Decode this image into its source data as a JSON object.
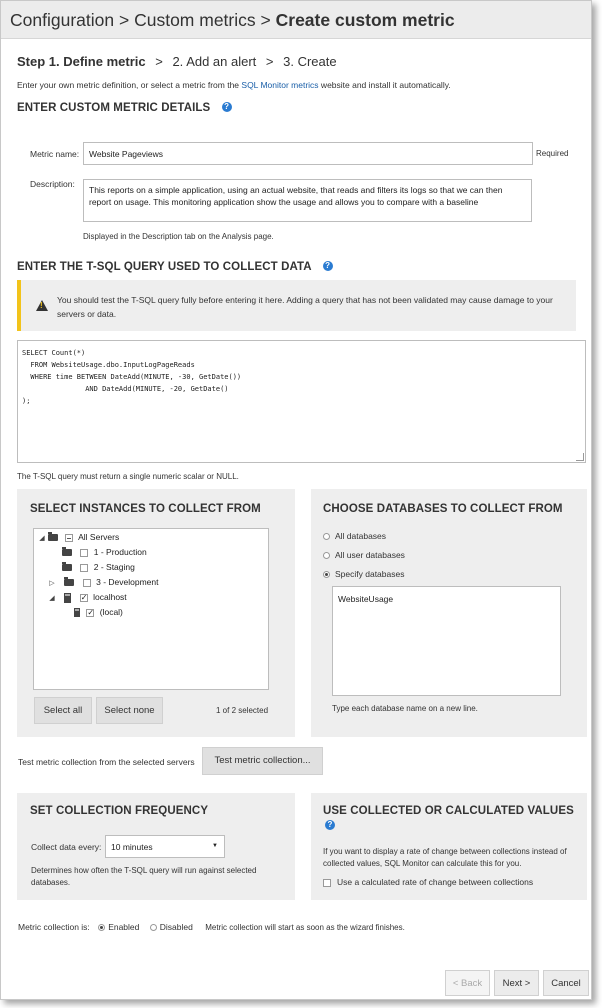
{
  "header": {
    "crumb1": "Configuration",
    "crumb2": "Custom metrics",
    "current": "Create custom metric",
    "sep": ">"
  },
  "steps": {
    "step1": "Step 1. Define metric",
    "step2": "2. Add an alert",
    "step3": "3. Create",
    "sep": ">"
  },
  "intro": {
    "before": "Enter your own metric definition, or select a metric from the ",
    "link": "SQL Monitor metrics",
    "after": " website and install it automatically."
  },
  "details": {
    "heading": "ENTER CUSTOM METRIC DETAILS",
    "name_label": "Metric name:",
    "name_value": "Website Pageviews",
    "required": "Required",
    "desc_label": "Description:",
    "desc_value": "This reports on  a simple application, using an actual website, that reads and filters its logs so that we can then report on usage.  This monitoring application  show the usage and allows you to compare with a baseline",
    "desc_hint": "Displayed in the Description tab on the Analysis page."
  },
  "query": {
    "heading": "ENTER THE T-SQL QUERY USED TO COLLECT DATA",
    "warning": "You should test the T-SQL query fully before entering it here. Adding a query that has not been validated may cause damage to your servers or data.",
    "sql": "SELECT Count(*)\n  FROM WebsiteUsage.dbo.InputLogPageReads\n  WHERE time BETWEEN DateAdd(MINUTE, -30, GetDate())\n               AND DateAdd(MINUTE, -20, GetDate()\n);",
    "hint": "The T-SQL query must return a single numeric scalar or NULL."
  },
  "instances": {
    "heading": "SELECT INSTANCES TO COLLECT FROM",
    "tree": [
      "All Servers",
      "1 - Production",
      "2 - Staging",
      "3 - Development",
      "localhost",
      "(local)"
    ],
    "select_all": "Select all",
    "select_none": "Select none",
    "count": "1 of 2 selected"
  },
  "databases": {
    "heading": "CHOOSE DATABASES TO COLLECT FROM",
    "options": [
      "All databases",
      "All user databases",
      "Specify databases"
    ],
    "selected": "Specify databases",
    "value": "WebsiteUsage",
    "hint": "Type each database name on a new line."
  },
  "test": {
    "label": "Test metric collection from the selected servers",
    "button": "Test metric collection..."
  },
  "frequency": {
    "heading": "SET COLLECTION FREQUENCY",
    "label": "Collect data every:",
    "value": "10 minutes",
    "hint": "Determines how often the T-SQL query will run against selected databases."
  },
  "values": {
    "heading": "USE COLLECTED OR CALCULATED VALUES",
    "text": "If you want to display a rate of change between collections instead of collected values, SQL Monitor can calculate this for you.",
    "checkbox": "Use a calculated rate of change between collections"
  },
  "collection": {
    "label": "Metric collection is:",
    "enabled": "Enabled",
    "disabled": "Disabled",
    "note": "Metric collection will start as soon as the wizard finishes.",
    "state": "Enabled"
  },
  "nav": {
    "back": "< Back",
    "next": "Next >",
    "cancel": "Cancel"
  },
  "colors": {
    "link": "#1a5fa8",
    "warning_bar": "#f2c31a",
    "help_icon": "#2a7bd1",
    "panel": "#eeeeee"
  }
}
